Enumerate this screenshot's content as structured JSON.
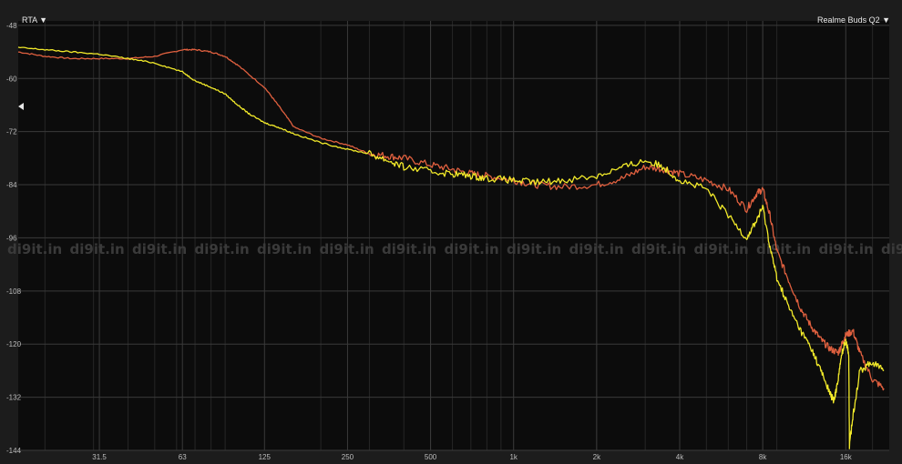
{
  "header": {
    "mode_label": "RTA ▼",
    "device_label": "Realme Buds Q2 ▼"
  },
  "watermark": "di9it.in",
  "colors": {
    "background": "#0c0c0c",
    "frame": "#1c1c1c",
    "grid": "#3a3a3a",
    "series_yellow": "#f2ea2a",
    "series_red": "#e0603f"
  },
  "chart_data": {
    "type": "line",
    "title": "",
    "xlabel": "",
    "ylabel": "",
    "x_scale": "log",
    "xlim": [
      16,
      23000
    ],
    "ylim": [
      -144,
      -47
    ],
    "grid": true,
    "x_ticks": [
      {
        "value": 31.5,
        "label": "31.5"
      },
      {
        "value": 63,
        "label": "63"
      },
      {
        "value": 125,
        "label": "125"
      },
      {
        "value": 250,
        "label": "250"
      },
      {
        "value": 500,
        "label": "500"
      },
      {
        "value": 1000,
        "label": "1k"
      },
      {
        "value": 2000,
        "label": "2k"
      },
      {
        "value": 4000,
        "label": "4k"
      },
      {
        "value": 8000,
        "label": "8k"
      },
      {
        "value": 16000,
        "label": "16k"
      }
    ],
    "y_ticks": [
      {
        "value": -48,
        "label": "-48"
      },
      {
        "value": -60,
        "label": "-60"
      },
      {
        "value": -72,
        "label": "-72"
      },
      {
        "value": -84,
        "label": "-84"
      },
      {
        "value": -96,
        "label": "-96"
      },
      {
        "value": -108,
        "label": "-108"
      },
      {
        "value": -120,
        "label": "-120"
      },
      {
        "value": -132,
        "label": "-132"
      },
      {
        "value": -144,
        "label": "-144"
      }
    ],
    "series": [
      {
        "color": "#e0603f",
        "x": [
          16,
          20,
          25,
          31.5,
          40,
          50,
          63,
          70,
          80,
          90,
          100,
          125,
          140,
          160,
          200,
          250,
          300,
          350,
          400,
          500,
          600,
          700,
          800,
          1000,
          1200,
          1500,
          2000,
          2500,
          3000,
          3500,
          4000,
          5000,
          6000,
          7000,
          7600,
          8000,
          8500,
          9000,
          10000,
          11000,
          12000,
          13000,
          14000,
          15000,
          15500,
          16000,
          17000,
          18000,
          20000,
          22000
        ],
        "y": [
          -54,
          -55,
          -55.5,
          -55.5,
          -55.5,
          -55,
          -53.5,
          -53.5,
          -54,
          -55,
          -57,
          -62,
          -66,
          -71,
          -73.5,
          -75,
          -77,
          -77.5,
          -78,
          -79.5,
          -80.5,
          -81.5,
          -82,
          -83,
          -84,
          -84.5,
          -84,
          -82.5,
          -80,
          -80.5,
          -81.5,
          -83,
          -85,
          -89.5,
          -86,
          -85,
          -91,
          -99,
          -106,
          -112,
          -116,
          -119,
          -121,
          -122,
          -120,
          -118,
          -117,
          -122,
          -128,
          -130
        ]
      },
      {
        "color": "#f2ea2a",
        "x": [
          16,
          20,
          25,
          31.5,
          40,
          50,
          63,
          70,
          80,
          90,
          100,
          110,
          125,
          140,
          160,
          200,
          250,
          300,
          350,
          400,
          500,
          600,
          700,
          800,
          1000,
          1200,
          1500,
          2000,
          2500,
          3000,
          3500,
          4000,
          5000,
          6000,
          7000,
          7600,
          8000,
          8500,
          9000,
          10000,
          11000,
          12000,
          13000,
          14000,
          14500,
          15000,
          15500,
          16000,
          16400,
          16500,
          17000,
          18000,
          20000,
          22000
        ],
        "y": [
          -53,
          -53.5,
          -54,
          -54.5,
          -55.5,
          -56.5,
          -58.5,
          -60.5,
          -62,
          -63.5,
          -66,
          -68,
          -70,
          -71,
          -72.5,
          -74.5,
          -76,
          -77,
          -78.5,
          -80,
          -81,
          -81.5,
          -82,
          -82.5,
          -83,
          -83.5,
          -83,
          -82,
          -80,
          -78.5,
          -80,
          -83,
          -85,
          -91,
          -96,
          -92,
          -89,
          -98,
          -105,
          -112,
          -117,
          -121,
          -126,
          -131,
          -133,
          -128,
          -122,
          -119,
          -122,
          -143,
          -136,
          -126,
          -124,
          -126
        ]
      }
    ]
  }
}
